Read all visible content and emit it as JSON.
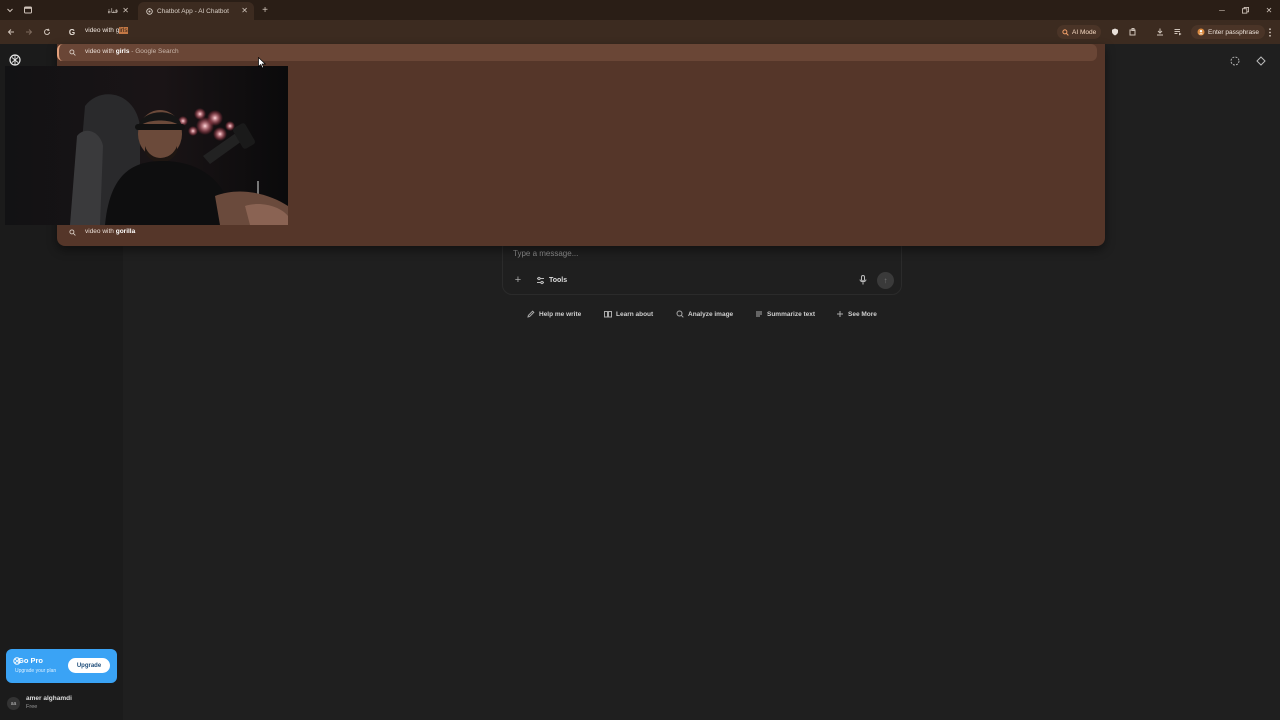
{
  "browser": {
    "tabs": [
      {
        "title": "قناة",
        "active": false
      },
      {
        "title": "Chatbot App - AI Chatbot",
        "active": true
      }
    ],
    "address_typed": "video with g",
    "address_autocomplete": "irls",
    "ai_mode_label": "AI Mode",
    "passphrase_label": "Enter passphrase",
    "accent_color": "#553629"
  },
  "omnibox_dropdown": {
    "suggestion_1": {
      "typed": "video with ",
      "bold": "girls",
      "suffix": " - Google Search"
    },
    "suggestion_2": {
      "typed": "video with ",
      "bold": "gorilla"
    }
  },
  "composer": {
    "placeholder": "Type a message...",
    "tools_label": "Tools"
  },
  "quick_actions": [
    {
      "label": "Help me write",
      "icon": "pencil-icon"
    },
    {
      "label": "Learn about",
      "icon": "book-icon"
    },
    {
      "label": "Analyze image",
      "icon": "search-icon"
    },
    {
      "label": "Summarize text",
      "icon": "lines-icon"
    },
    {
      "label": "See More",
      "icon": "plus-icon"
    }
  ],
  "sidebar": {
    "go_pro_title": "Go Pro",
    "go_pro_subtitle": "Upgrade your plan",
    "upgrade_label": "Upgrade",
    "user_initials": "aa",
    "user_name": "amer alghamdi",
    "user_plan": "Free"
  }
}
